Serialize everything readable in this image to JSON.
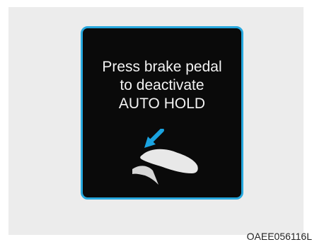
{
  "message": {
    "line1": "Press brake pedal",
    "line2": "to deactivate",
    "line3": "AUTO HOLD"
  },
  "icon": "brake-pedal-press-icon",
  "image_code": "OAEE056116L",
  "colors": {
    "display_background": "#0a0a0a",
    "display_border": "#27a8de",
    "arrow": "#1aa3e0",
    "text": "#f2f2f2",
    "panel_background": "#ececec"
  }
}
